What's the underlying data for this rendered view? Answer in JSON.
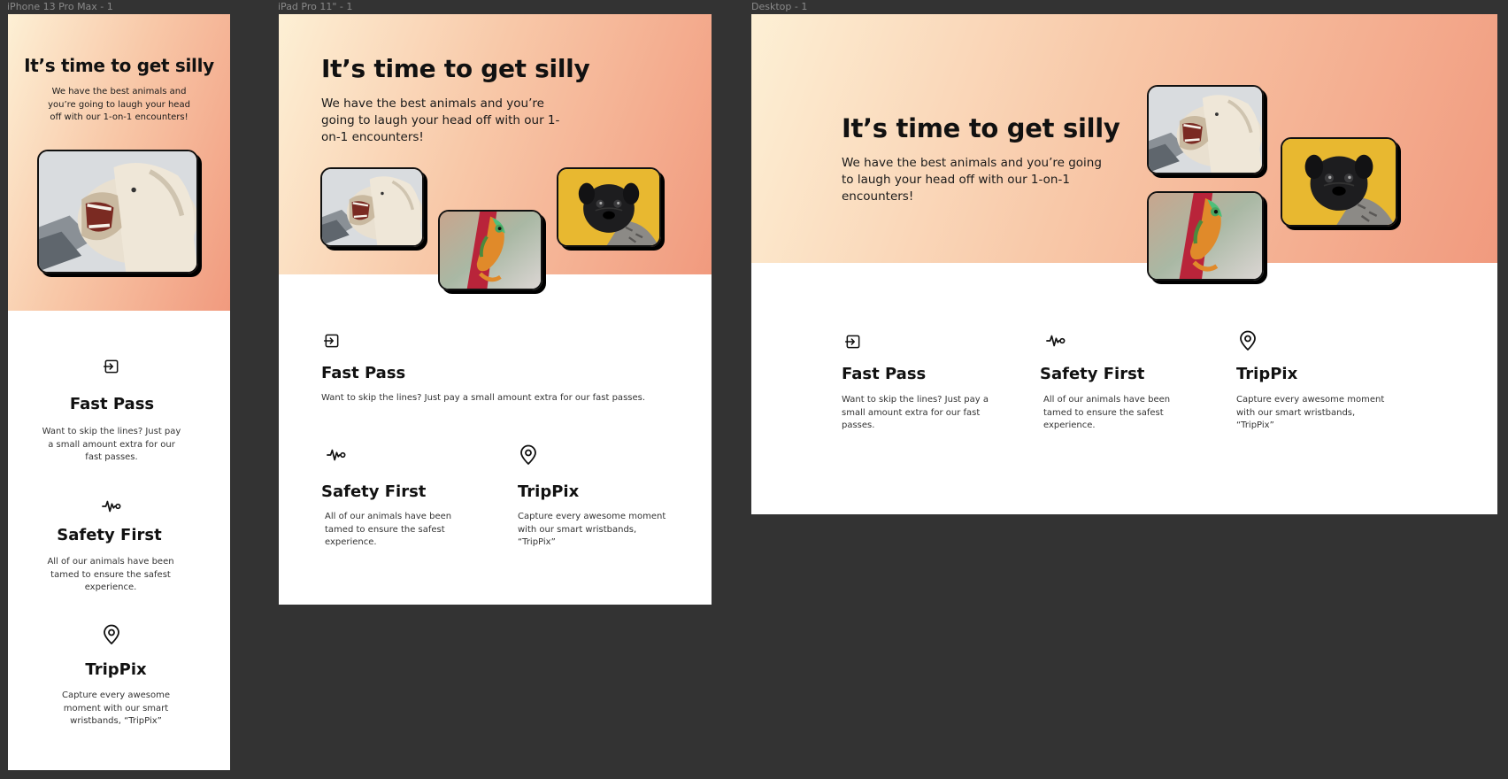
{
  "frames": {
    "phone_label": "iPhone 13 Pro Max - 1",
    "tablet_label": "iPad Pro 11\" - 1",
    "desktop_label": "Desktop - 1"
  },
  "hero": {
    "title": "It’s time to get silly",
    "subtitle": "We have the best animals and you’re going to laugh your head off with our 1-on-1 encounters!"
  },
  "images": [
    {
      "name": "laughing-horse",
      "alt": "Laughing horse"
    },
    {
      "name": "chameleon",
      "alt": "Chameleon on branch"
    },
    {
      "name": "pug",
      "alt": "Pug on yellow background"
    }
  ],
  "features": [
    {
      "icon": "enter-icon",
      "title": "Fast Pass",
      "text": "Want to skip the lines? Just pay a small amount extra for our fast passes."
    },
    {
      "icon": "heartbeat-icon",
      "title": "Safety First",
      "text": "All of our animals have been tamed to ensure the safest experience."
    },
    {
      "icon": "map-pin-icon",
      "title": "TripPix",
      "text": "Capture every awesome moment with our smart wristbands, “TripPix”"
    }
  ],
  "colors": {
    "gradient_start": "#fdf0d5",
    "gradient_end": "#f19a7e",
    "canvas_background": "#333333",
    "pug_background": "#e8b830"
  }
}
